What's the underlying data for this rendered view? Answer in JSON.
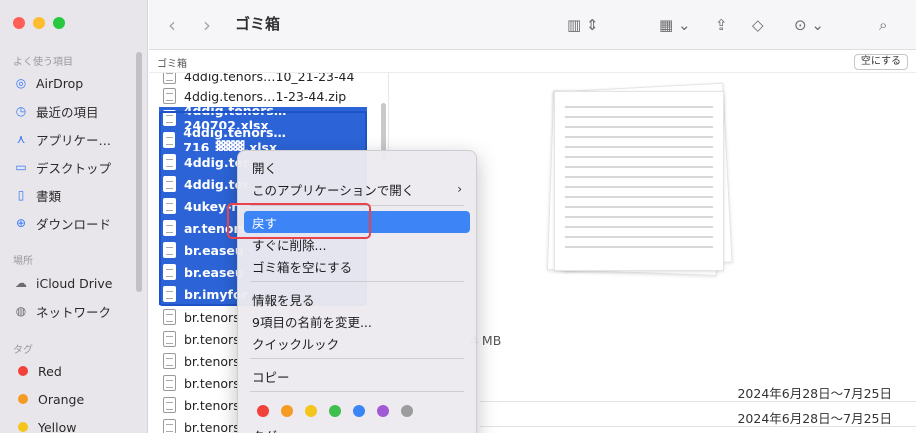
{
  "window": {
    "title": "ゴミ箱"
  },
  "sidebar": {
    "favorites_header": "よく使う項目",
    "favorites": [
      {
        "label": "AirDrop",
        "icon": "airdrop-icon"
      },
      {
        "label": "最近の項目",
        "icon": "clock-icon"
      },
      {
        "label": "アプリケー…",
        "icon": "applications-icon"
      },
      {
        "label": "デスクトップ",
        "icon": "desktop-icon"
      },
      {
        "label": "書類",
        "icon": "document-icon"
      },
      {
        "label": "ダウンロード",
        "icon": "download-icon"
      }
    ],
    "locations_header": "場所",
    "locations": [
      {
        "label": "iCloud Drive",
        "icon": "cloud-icon"
      },
      {
        "label": "ネットワーク",
        "icon": "network-icon"
      }
    ],
    "tags_header": "タグ",
    "tags": [
      {
        "label": "Red",
        "color": "#f0423b"
      },
      {
        "label": "Orange",
        "color": "#f59a23"
      },
      {
        "label": "Yellow",
        "color": "#f4c51b"
      }
    ]
  },
  "toolbar": {
    "back_icon": "chevron-left-icon",
    "forward_icon": "chevron-right-icon",
    "view_icon": "columns-view-icon",
    "group_icon": "grid-group-icon",
    "share_icon": "share-icon",
    "tag_icon": "tag-icon",
    "more_icon": "ellipsis-icon",
    "search_icon": "search-icon"
  },
  "pathbar": {
    "crumb": "ゴミ箱",
    "empty_button": "空にする"
  },
  "files": [
    {
      "name": "4ddig.tenors…10_21-23-44",
      "selected": false
    },
    {
      "name": "4ddig.tenors…1-23-44.zip",
      "selected": false
    },
    {
      "name": "4ddig.tenors…240702.xlsx",
      "selected": true
    },
    {
      "name": "4ddig.tenors…716_▓▓▓.xlsx",
      "selected": true
    },
    {
      "name": "4ddig.ter",
      "selected": true
    },
    {
      "name": "4ddig.ter",
      "selected": true
    },
    {
      "name": "4ukey-n",
      "selected": true
    },
    {
      "name": "ar.tenors",
      "selected": true
    },
    {
      "name": "br.easeu",
      "selected": true
    },
    {
      "name": "br.easeu",
      "selected": true
    },
    {
      "name": "br.imyfor",
      "selected": true
    },
    {
      "name": "br.tenors",
      "selected": false
    },
    {
      "name": "br.tenors",
      "selected": false
    },
    {
      "name": "br.tenors",
      "selected": false
    },
    {
      "name": "br.tenors",
      "selected": false
    },
    {
      "name": "br.tenors",
      "selected": false
    },
    {
      "name": "br.tenors",
      "selected": false
    }
  ],
  "preview": {
    "size_fragment": "4 MB",
    "date_range_1": "2024年6月28日〜7月25日",
    "date_range_2": "2024年6月28日〜7月25日"
  },
  "context_menu": {
    "open": "開く",
    "open_with": "このアプリケーションで開く",
    "put_back": "戻す",
    "delete_immediately": "すぐに削除...",
    "empty_trash": "ゴミ箱を空にする",
    "get_info": "情報を見る",
    "rename": "9項目の名前を変更...",
    "quick_look": "クイックルック",
    "copy": "コピー",
    "tags": "タグ...",
    "tag_colors": [
      "#f0423b",
      "#f59a23",
      "#f4c51b",
      "#3fbf4b",
      "#3a86f5",
      "#a05ad6",
      "#9c9c9e"
    ]
  },
  "highlight_box_color": "#e8424a"
}
